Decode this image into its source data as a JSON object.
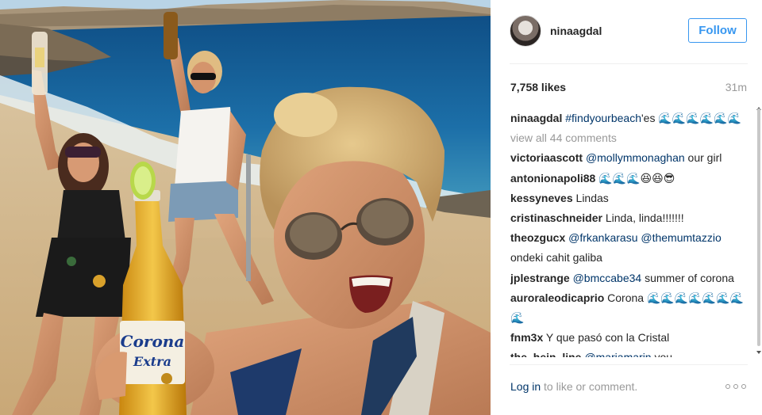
{
  "post": {
    "username": "ninaagdal",
    "follow_label": "Follow",
    "likes": "7,758 likes",
    "time_ago": "31m"
  },
  "caption": {
    "user": "ninaagdal",
    "hashtag": "#findyourbeach",
    "text_after": "'es 🌊🌊🌊🌊🌊🌊"
  },
  "view_all": "view all 44 comments",
  "comments": [
    {
      "user": "victoriaascott",
      "mention": "@mollymmonaghan",
      "text": " our girl"
    },
    {
      "user": "antonionapoli88",
      "mention": "",
      "text": " 🌊🌊🌊😆😆😎"
    },
    {
      "user": "kessyneves",
      "mention": "",
      "text": " Lindas"
    },
    {
      "user": "cristinaschneider",
      "mention": "",
      "text": " Linda, linda!!!!!!!"
    },
    {
      "user": "theozgucx",
      "mention": "@frkankarasu @themumtazzio",
      "text": " ondeki cahit galiba"
    },
    {
      "user": "jplestrange",
      "mention": "@bmccabe34",
      "text": " summer of corona"
    },
    {
      "user": "auroraleodicaprio",
      "mention": "",
      "text": " Corona 🌊🌊🌊🌊🌊🌊🌊🌊"
    },
    {
      "user": "fnm3x",
      "mention": "",
      "text": " Y que pasó con la Cristal"
    },
    {
      "user": "the_hein_line",
      "mention": "@mariamarin",
      "text": " you"
    }
  ],
  "footer": {
    "login_label": "Log in",
    "login_suffix": " to like or comment."
  },
  "photo": {
    "bottle_brand": "Corona",
    "bottle_sub": "Extra"
  },
  "colors": {
    "accent": "#3897f0",
    "link": "#003569",
    "muted": "#999999"
  }
}
